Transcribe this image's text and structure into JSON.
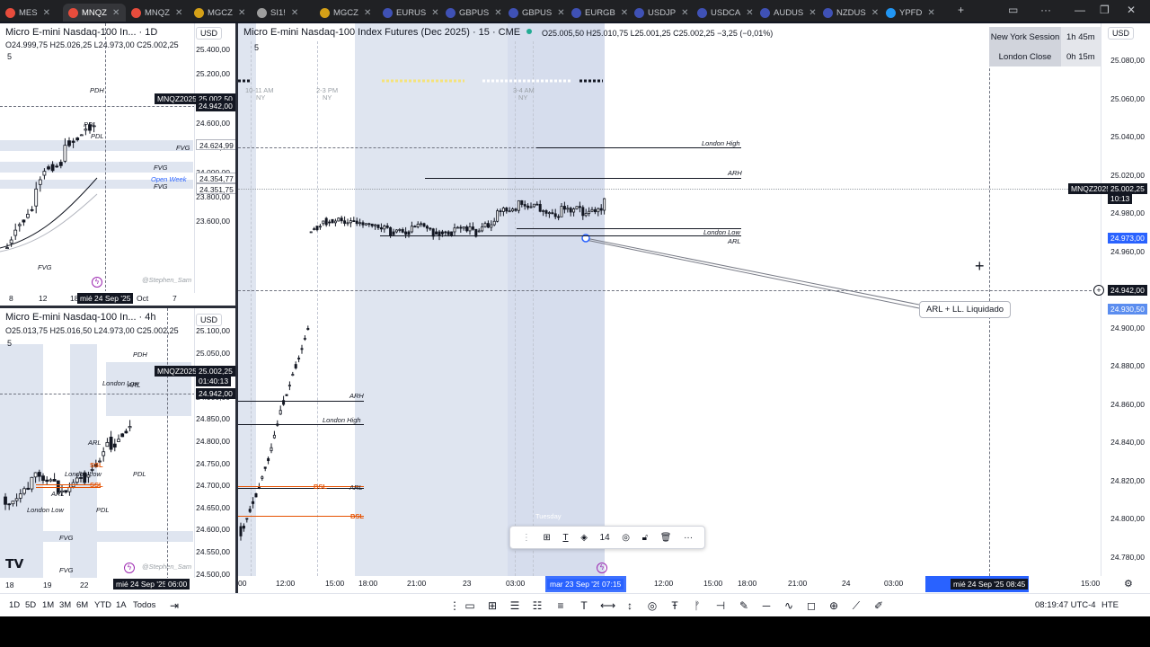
{
  "tabs": [
    {
      "label": "MES",
      "color": "#e74c3c",
      "active": false
    },
    {
      "label": "MNQZ",
      "color": "#e74c3c",
      "active": true
    },
    {
      "label": "MNQZ",
      "color": "#e74c3c",
      "active": false
    },
    {
      "label": "MGCZ",
      "color": "#d4a017",
      "active": false
    },
    {
      "label": "SI1!",
      "color": "#9e9e9e",
      "active": false
    },
    {
      "label": "MGCZ",
      "color": "#d4a017",
      "active": false
    },
    {
      "label": "EURUS",
      "color": "#3f51b5",
      "active": false
    },
    {
      "label": "GBPUS",
      "color": "#3f51b5",
      "active": false
    },
    {
      "label": "GBPUS",
      "color": "#3f51b5",
      "active": false
    },
    {
      "label": "EURGB",
      "color": "#3f51b5",
      "active": false
    },
    {
      "label": "USDJP",
      "color": "#3f51b5",
      "active": false
    },
    {
      "label": "USDCA",
      "color": "#3f51b5",
      "active": false
    },
    {
      "label": "AUDUS",
      "color": "#3f51b5",
      "active": false
    },
    {
      "label": "NZDUS",
      "color": "#3f51b5",
      "active": false
    },
    {
      "label": "YPFD",
      "color": "#2196f3",
      "active": false
    }
  ],
  "chart_d": {
    "title": "Micro E-mini Nasdaq-100 In... · 1D",
    "ohlc": "O24.999,75 H25.026,25 L24.973,00 C25.002,25",
    "indicator_count": "5",
    "currency": "USD",
    "prices": [
      "25.400,00",
      "25.200,00",
      "24.800,00",
      "24.600,00",
      "24.200,00",
      "24.000,00",
      "23.800,00",
      "23.600,00"
    ],
    "tags": {
      "symbol": "MNQZ2025",
      "last": "25.002,50",
      "cross": "24.942,00",
      "l1": "24.624,99",
      "l2": "24.354,77",
      "l3": "24.351,75"
    },
    "times": [
      "8",
      "12",
      "18",
      "Oct",
      "7"
    ],
    "current_time": "mié 24 Sep '25",
    "levels": {
      "pdh": "PDH",
      "pdl": "PDL",
      "fvg": "FVG",
      "open_week": "Open Week",
      "watermark": "@Stephen_Sam"
    }
  },
  "chart_4h": {
    "title": "Micro E-mini Nasdaq-100 In... · 4h",
    "ohlc": "O25.013,75 H25.016,50 L24.973,00 C25.002,25",
    "indicator_count": "5",
    "currency": "USD",
    "prices": [
      "25.100,00",
      "25.050,00",
      "24.950,00",
      "24.900,00",
      "24.850,00",
      "24.800,00",
      "24.750,00",
      "24.700,00",
      "24.650,00",
      "24.600,00",
      "24.550,00",
      "24.500,00"
    ],
    "tags": {
      "symbol": "MNQZ2025",
      "last": "25.002,25",
      "countdown": "01:40:13",
      "cross": "24.942,00"
    },
    "times": [
      "18",
      "19",
      "22"
    ],
    "current_time": "mié 24 Sep '25",
    "current_clock": "06:00",
    "levels": {
      "pdh": "PDH",
      "pdl": "PDL",
      "arl": "ARL",
      "ssl": "SSL",
      "london_low": "London Low",
      "london_high": "London High",
      "fvg": "FVG",
      "watermark": "@Stephen_Sam"
    }
  },
  "chart_main": {
    "title": "Micro E-mini Nasdaq-100 Index Futures (Dec 2025) · 15 · CME",
    "ohlc": "O25.005,50 H25.010,75 L25.001,25 C25.002,25 −3,25 (−0,01%)",
    "indicator_count": "5",
    "currency": "USD",
    "prices": [
      "25.080,00",
      "25.060,00",
      "25.040,00",
      "25.020,00",
      "24.980,00",
      "24.960,00",
      "24.920,00",
      "24.900,00",
      "24.880,00",
      "24.860,00",
      "24.840,00",
      "24.820,00",
      "24.800,00",
      "24.780,00"
    ],
    "tags": {
      "symbol": "MNQZ2025",
      "last": "25.002,25",
      "countdown": "10:13",
      "blue1": "24.973,00",
      "cross": "24.942,00",
      "blue2": "24.930,50"
    },
    "times": [
      "00",
      "12:00",
      "15:00",
      "18:00",
      "21:00",
      "23",
      "03:00",
      "12:00",
      "15:00",
      "18:00",
      "21:00",
      "24",
      "03:00",
      "12:00",
      "15:00"
    ],
    "selected_time_start": "mar 23 Sep '25",
    "selected_time_clock": "07:15",
    "cursor_time": "mié 24 Sep '25",
    "cursor_clock": "08:45",
    "session_labels": [
      "10-11 AM",
      "NY",
      "2-3 PM",
      "NY",
      "3-4 AM",
      "NY"
    ],
    "day_label": "Tuesday",
    "levels": {
      "london_high": "London High",
      "arh": "ARH",
      "london_low": "London Low",
      "arl": "ARL",
      "ny_midnight": "NY Midnight Open | 25003"
    },
    "annotation": "ARL + LL. Liquidado",
    "sessions": [
      {
        "name": "New York Session",
        "value": "1h 45m"
      },
      {
        "name": "London Close",
        "value": "0h 15m"
      }
    ]
  },
  "floating_toolbar": {
    "font_size": "14"
  },
  "bottom_bar": {
    "timeframes": [
      "1D",
      "5D",
      "1M",
      "3M",
      "6M",
      "YTD",
      "1A",
      "Todos"
    ],
    "clock": "08:19:47 UTC-4",
    "mode": "HTE"
  },
  "colors": {
    "accent_blue": "#2962ff",
    "candle_dark": "#131722",
    "candle_light": "#ffffff",
    "session_shade": "#dfe5f0",
    "level_red": "#e65100"
  }
}
